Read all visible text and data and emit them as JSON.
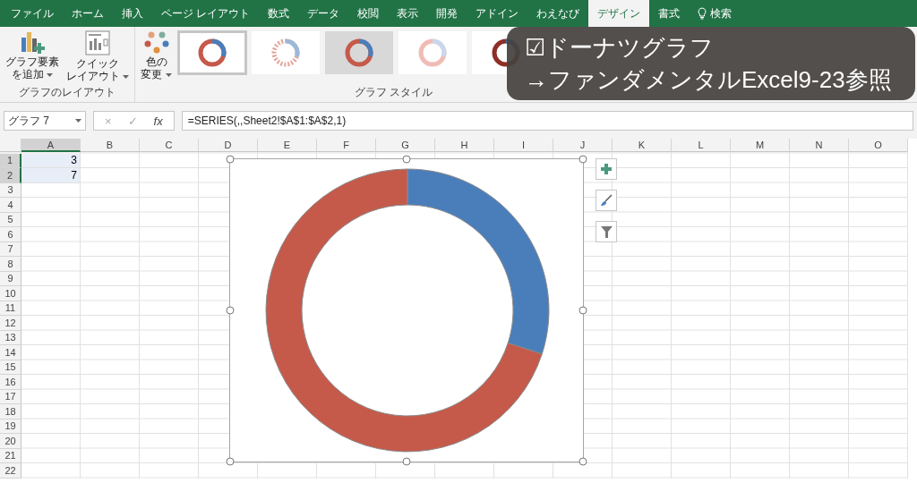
{
  "ribbon_tabs": [
    {
      "label": "ファイル",
      "selected": false
    },
    {
      "label": "ホーム",
      "selected": false
    },
    {
      "label": "挿入",
      "selected": false
    },
    {
      "label": "ページ レイアウト",
      "selected": false
    },
    {
      "label": "数式",
      "selected": false
    },
    {
      "label": "データ",
      "selected": false
    },
    {
      "label": "校閲",
      "selected": false
    },
    {
      "label": "表示",
      "selected": false
    },
    {
      "label": "開発",
      "selected": false
    },
    {
      "label": "アドイン",
      "selected": false
    },
    {
      "label": "わえなび",
      "selected": false
    },
    {
      "label": "デザイン",
      "selected": true
    },
    {
      "label": "書式",
      "selected": false
    }
  ],
  "search": {
    "label": "検索"
  },
  "ribbon": {
    "layout_group": {
      "label": "グラフのレイアウト",
      "buttons": [
        {
          "kind": "add-element",
          "lines": [
            "グラフ要素",
            "を追加"
          ]
        },
        {
          "kind": "quick-layout",
          "lines": [
            "クイック",
            "レイアウト"
          ]
        }
      ]
    },
    "color_button": {
      "lines": [
        "色の",
        "変更"
      ]
    },
    "style_group": {
      "label": "グラフ スタイル",
      "styles": [
        {
          "kind": "plain",
          "selected": true
        },
        {
          "kind": "striped",
          "selected": false
        },
        {
          "kind": "shaded",
          "selected": false
        },
        {
          "kind": "pale",
          "selected": false
        },
        {
          "kind": "dark",
          "selected": false
        }
      ]
    }
  },
  "overlay": {
    "lines": [
      "☑ドーナツグラフ",
      "→ファンダメンタルExcel9-23参照"
    ]
  },
  "formula_bar": {
    "name_box": "グラフ 7",
    "cancel": "×",
    "enter": "✓",
    "function": "fx",
    "formula": "=SERIES(,,Sheet2!$A$1:$A$2,1)"
  },
  "columns": [
    {
      "label": "A",
      "selected": true
    },
    {
      "label": "B",
      "selected": false
    },
    {
      "label": "C",
      "selected": false
    },
    {
      "label": "D",
      "selected": false
    },
    {
      "label": "E",
      "selected": false
    },
    {
      "label": "F",
      "selected": false
    },
    {
      "label": "G",
      "selected": false
    },
    {
      "label": "H",
      "selected": false
    },
    {
      "label": "I",
      "selected": false
    },
    {
      "label": "J",
      "selected": false
    },
    {
      "label": "K",
      "selected": false
    },
    {
      "label": "L",
      "selected": false
    },
    {
      "label": "M",
      "selected": false
    },
    {
      "label": "N",
      "selected": false
    },
    {
      "label": "O",
      "selected": false
    }
  ],
  "rows": [
    {
      "label": "1",
      "value": "3",
      "selected": true
    },
    {
      "label": "2",
      "value": "7",
      "selected": true
    },
    {
      "label": "3",
      "selected": false
    },
    {
      "label": "4",
      "selected": false
    },
    {
      "label": "5",
      "selected": false
    },
    {
      "label": "6",
      "selected": false
    },
    {
      "label": "7",
      "selected": false
    },
    {
      "label": "8",
      "selected": false
    },
    {
      "label": "9",
      "selected": false
    },
    {
      "label": "10",
      "selected": false
    },
    {
      "label": "11",
      "selected": false
    },
    {
      "label": "12",
      "selected": false
    },
    {
      "label": "13",
      "selected": false
    },
    {
      "label": "14",
      "selected": false
    },
    {
      "label": "15",
      "selected": false
    },
    {
      "label": "16",
      "selected": false
    },
    {
      "label": "17",
      "selected": false
    },
    {
      "label": "18",
      "selected": false
    },
    {
      "label": "19",
      "selected": false
    },
    {
      "label": "20",
      "selected": false
    },
    {
      "label": "21",
      "selected": false
    },
    {
      "label": "22",
      "selected": false
    }
  ],
  "chart": {
    "selected": true,
    "chart_data": {
      "type": "donut",
      "series": [
        {
          "values": [
            30,
            70
          ]
        }
      ]
    }
  }
}
